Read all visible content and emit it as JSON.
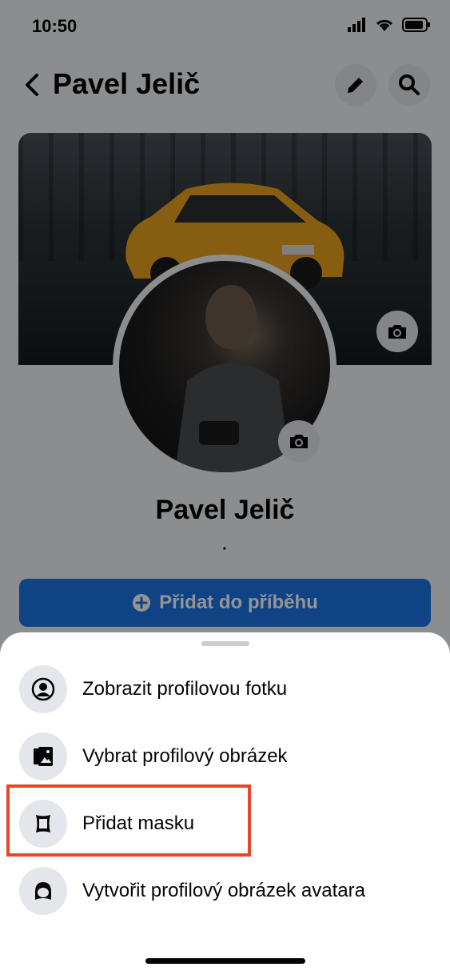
{
  "status_bar": {
    "time": "10:50"
  },
  "header": {
    "title": "Pavel Jelič"
  },
  "profile": {
    "name": "Pavel Jelič",
    "separator": "·",
    "add_story_label": "Přidat do příběhu"
  },
  "sheet": {
    "items": [
      {
        "label": "Zobrazit profilovou fotku",
        "icon": "profile-circle-icon"
      },
      {
        "label": "Vybrat profilový obrázek",
        "icon": "photo-album-icon"
      },
      {
        "label": "Přidat masku",
        "icon": "frame-icon"
      },
      {
        "label": "Vytvořit profilový obrázek avatara",
        "icon": "avatar-icon"
      }
    ]
  },
  "colors": {
    "accent": "#1b74e4",
    "highlight": "#e8462b"
  }
}
